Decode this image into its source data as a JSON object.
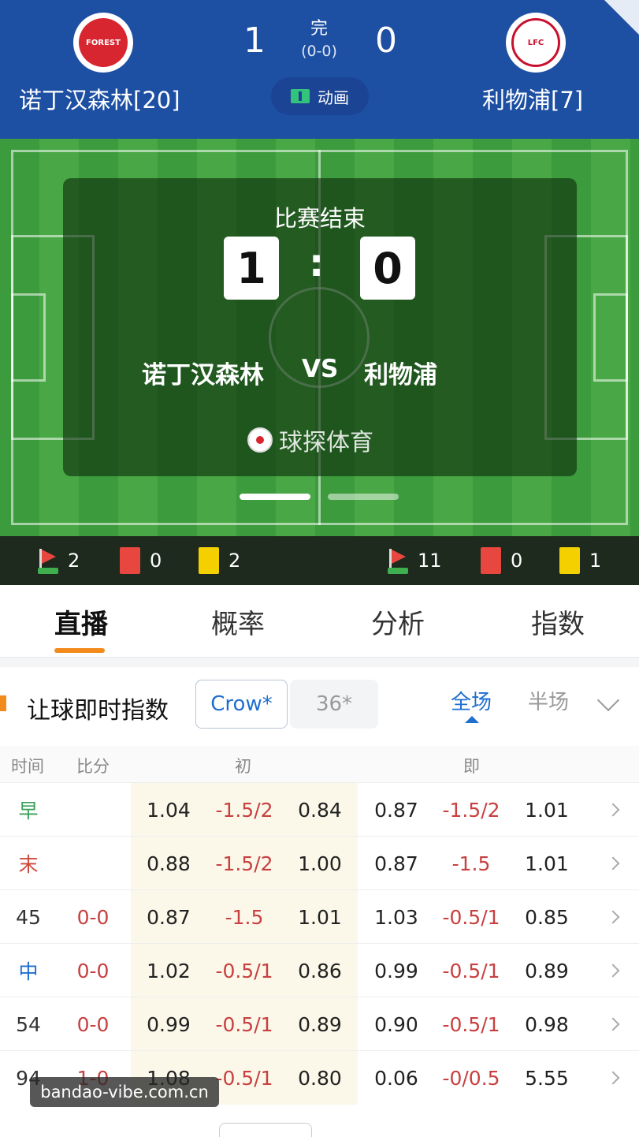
{
  "header": {
    "home": {
      "name": "诺丁汉森林[20]",
      "logo_text": "FOREST",
      "score": "1"
    },
    "away": {
      "name": "利物浦[7]",
      "logo_text": "LFC",
      "score": "0"
    },
    "status": "完",
    "half_score": "(0-0)",
    "animation_label": "动画"
  },
  "pitch_overlay": {
    "title": "比赛结束",
    "home_score": "1",
    "separator": ":",
    "away_score": "0",
    "home_name": "诺丁汉森林",
    "vs": "VS",
    "away_name": "利物浦",
    "brand": "球探体育"
  },
  "stats": {
    "home": {
      "corners": "2",
      "red": "0",
      "yellow": "2"
    },
    "away": {
      "corners": "11",
      "red": "0",
      "yellow": "1"
    }
  },
  "tabs": [
    {
      "label": "直播",
      "active": true
    },
    {
      "label": "概率"
    },
    {
      "label": "分析"
    },
    {
      "label": "指数"
    }
  ],
  "odds": {
    "title": "让球即时指数",
    "companies": [
      "Crow*",
      "36*"
    ],
    "scope_full": "全场",
    "scope_half": "半场",
    "headers": {
      "time": "时间",
      "score": "比分",
      "initial": "初",
      "live": "即"
    },
    "rows": [
      {
        "time": "早",
        "score": "",
        "o1": "1.04",
        "o2": "-1.5/2",
        "o3": "0.84",
        "o4": "0.87",
        "o5": "-1.5/2",
        "o6": "1.01"
      },
      {
        "time": "末",
        "score": "",
        "o1": "0.88",
        "o2": "-1.5/2",
        "o3": "1.00",
        "o4": "0.87",
        "o5": "-1.5",
        "o6": "1.01"
      },
      {
        "time": "45",
        "score": "0-0",
        "o1": "0.87",
        "o2": "-1.5",
        "o3": "1.01",
        "o4": "1.03",
        "o5": "-0.5/1",
        "o6": "0.85"
      },
      {
        "time": "中",
        "score": "0-0",
        "o1": "1.02",
        "o2": "-0.5/1",
        "o3": "0.86",
        "o4": "0.99",
        "o5": "-0.5/1",
        "o6": "0.89"
      },
      {
        "time": "54",
        "score": "0-0",
        "o1": "0.99",
        "o2": "-0.5/1",
        "o3": "0.89",
        "o4": "0.90",
        "o5": "-0.5/1",
        "o6": "0.98"
      },
      {
        "time": "94",
        "score": "1-0",
        "o1": "1.08",
        "o2": "-0.5/1",
        "o3": "0.80",
        "o4": "0.06",
        "o5": "-0/0.5",
        "o6": "5.55"
      }
    ]
  },
  "watermark": "bandao-vibe.com.cn",
  "colors": {
    "header_bg": "#1d4fa3",
    "accent_orange": "#f28a1c",
    "accent_blue": "#1f6fcf",
    "negative_red": "#c84040",
    "time_green": "#3aa05a",
    "time_red": "#d04a3a"
  }
}
